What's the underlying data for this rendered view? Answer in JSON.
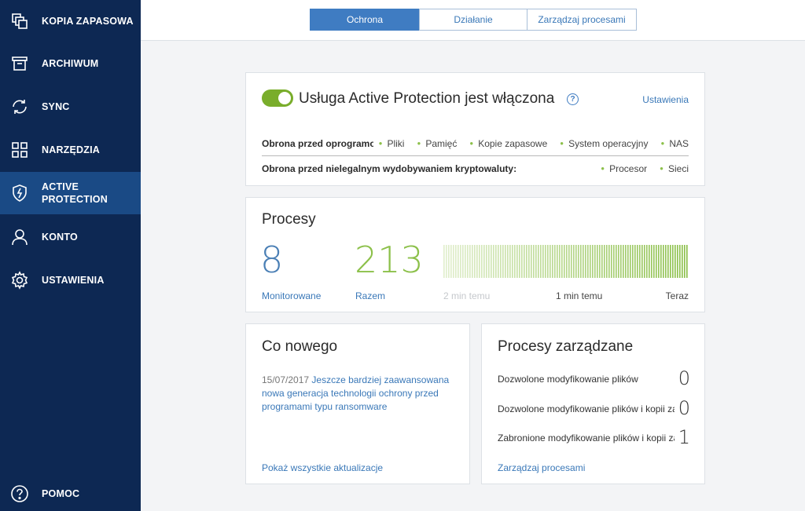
{
  "sidebar": {
    "items": [
      {
        "label": "KOPIA ZAPASOWA",
        "icon": "backup-copy-icon"
      },
      {
        "label": "ARCHIWUM",
        "icon": "archive-icon"
      },
      {
        "label": "SYNC",
        "icon": "sync-icon"
      },
      {
        "label": "NARZĘDZIA",
        "icon": "tools-grid-icon"
      },
      {
        "label": "ACTIVE\nPROTECTION",
        "icon": "shield-bolt-icon"
      },
      {
        "label": "KONTO",
        "icon": "user-icon"
      },
      {
        "label": "USTAWIENIA",
        "icon": "gear-icon"
      }
    ],
    "active_index": 4,
    "help": {
      "label": "POMOC",
      "icon": "help-icon"
    }
  },
  "tabs": [
    {
      "label": "Ochrona"
    },
    {
      "label": "Działanie"
    },
    {
      "label": "Zarządzaj procesami"
    }
  ],
  "protection": {
    "title": "Usługa Active Protection jest włączona",
    "help_glyph": "?",
    "settings_link": "Ustawienia",
    "row1": {
      "label": "Obrona przed oprogramowaniem ransomware:",
      "items": [
        "Pliki",
        "Pamięć",
        "Kopie zapasowe",
        "System operacyjny",
        "NAS"
      ]
    },
    "row2": {
      "label": "Obrona przed nielegalnym wydobywaniem kryptowaluty:",
      "items": [
        "Procesor",
        "Sieci"
      ]
    }
  },
  "processes": {
    "title": "Procesy",
    "monitored_value": "8",
    "monitored_label": "Monitorowane",
    "total_value": "213",
    "total_label": "Razem",
    "time_labels": [
      "2 min temu",
      "1 min temu",
      "Teraz"
    ]
  },
  "news": {
    "title": "Co nowego",
    "date": "15/07/2017",
    "text": "Jeszcze bardziej zaawansowana nowa generacja technologii ochrony przed programami typu ransomware",
    "link": "Pokaż wszystkie aktualizacje"
  },
  "managed": {
    "title": "Procesy zarządzane",
    "rows": [
      {
        "label": "Dozwolone modyfikowanie plików",
        "value": "0"
      },
      {
        "label": "Dozwolone modyfikowanie plików i kopii zapasowych",
        "value": "0"
      },
      {
        "label": "Zabronione modyfikowanie plików i kopii zapasowych",
        "value": "1"
      }
    ],
    "link": "Zarządzaj procesami"
  },
  "colors": {
    "sidebar_bg": "#0d2853",
    "sidebar_active": "#1a4a85",
    "accent_blue": "#3f7cc2",
    "accent_green": "#8cc04a"
  }
}
